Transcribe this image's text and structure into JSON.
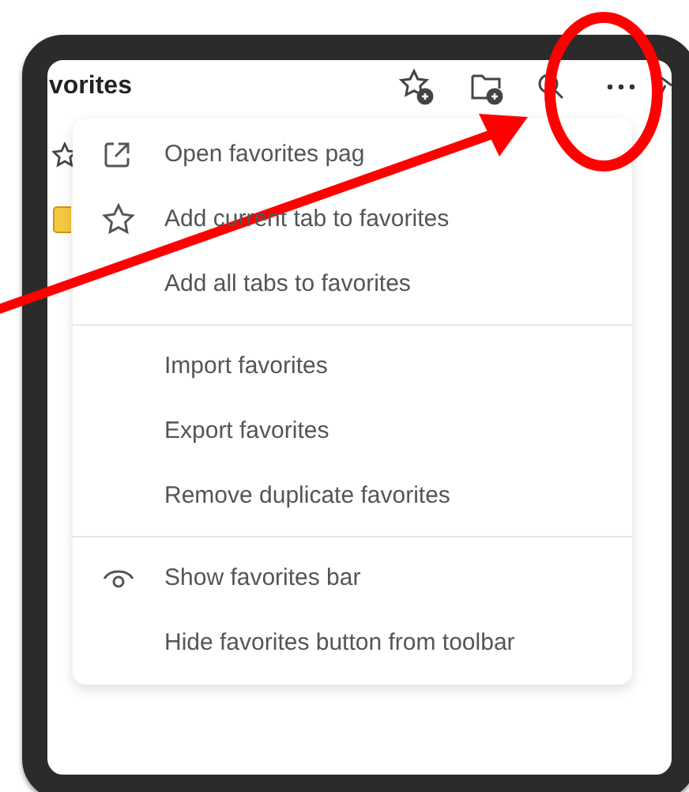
{
  "panel": {
    "title": "vorites"
  },
  "menu": {
    "groups": [
      [
        {
          "kind": "external",
          "label": "Open favorites pag"
        },
        {
          "kind": "star",
          "label": "Add current tab to favorites"
        },
        {
          "kind": "plain",
          "label": "Add all tabs to favorites"
        }
      ],
      [
        {
          "kind": "plain",
          "label": "Import favorites"
        },
        {
          "kind": "plain",
          "label": "Export favorites"
        },
        {
          "kind": "plain",
          "label": "Remove duplicate favorites"
        }
      ],
      [
        {
          "kind": "eye",
          "label": "Show favorites bar"
        },
        {
          "kind": "plain",
          "label": "Hide favorites button from toolbar"
        }
      ]
    ]
  }
}
